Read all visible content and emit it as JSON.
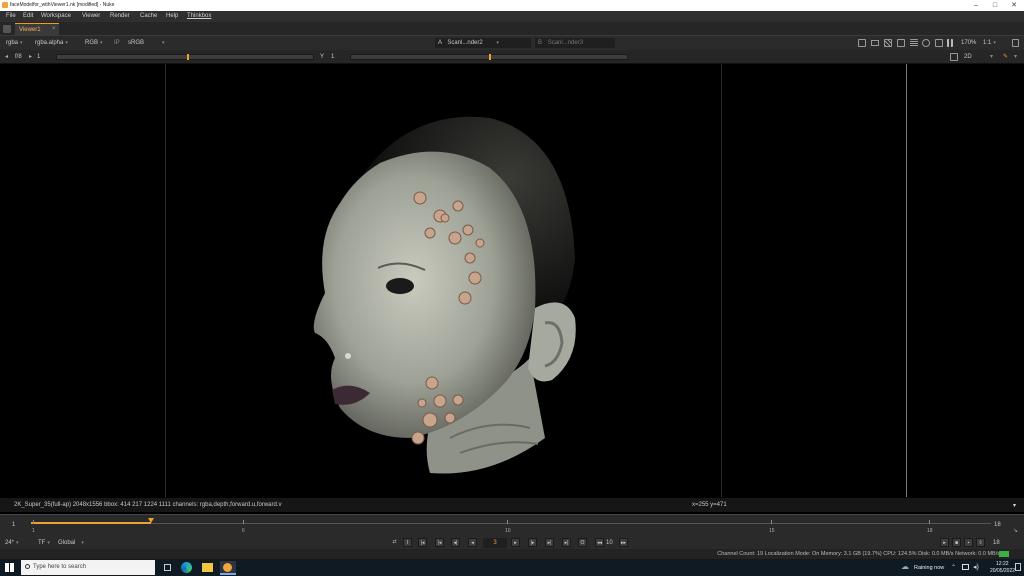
{
  "window": {
    "title": "faceModelfor_withViewer1.nk [modified] - Nuke"
  },
  "menu": [
    "File",
    "Edit",
    "Workspace",
    "Viewer",
    "Render",
    "Cache",
    "Help",
    "Thinkbox"
  ],
  "tab": {
    "label": "Viewer1",
    "close": "×"
  },
  "toolbar1": {
    "channels": "rgba",
    "alpha": "rgba.alpha",
    "color_mode": "RGB",
    "ip": "IP",
    "lut": "sRGB",
    "input_a_letter": "A",
    "input_a": "Scanl...nder2",
    "input_b_letter": "B",
    "input_b": "Scanl...nder3",
    "zoom": "170%",
    "ratio": "1:1"
  },
  "toolbar2": {
    "fstop": "f/8",
    "gain_value": "1",
    "y_label": "Y",
    "gamma_value": "1",
    "view_mode": "2D"
  },
  "infobar": {
    "format": "2K_Super_35(full-ap) 2048x1556  bbox: 414 217 1224 1111 channels: rgba,depth,forward.u,forward.v",
    "coords": "x=255 y=471"
  },
  "timeline": {
    "start": "1",
    "end": "18",
    "labels": [
      "1",
      "6",
      "10",
      "15",
      "18"
    ],
    "current_fraction": 0.125
  },
  "playbar": {
    "fps": "24*",
    "tf": "TF",
    "scope": "Global",
    "current_frame": "3",
    "step": "10",
    "end_frame": "18"
  },
  "status": "Channel Count: 19  Localization Mode: On  Memory: 3.1 GB (19.7%)  CPU: 124.5%  Disk: 0.0 MB/s  Network: 0.0 MB/s",
  "taskbar": {
    "search_placeholder": "Type here to search",
    "weather": "Raining now",
    "time": "12:22",
    "date": "20/05/2022"
  }
}
